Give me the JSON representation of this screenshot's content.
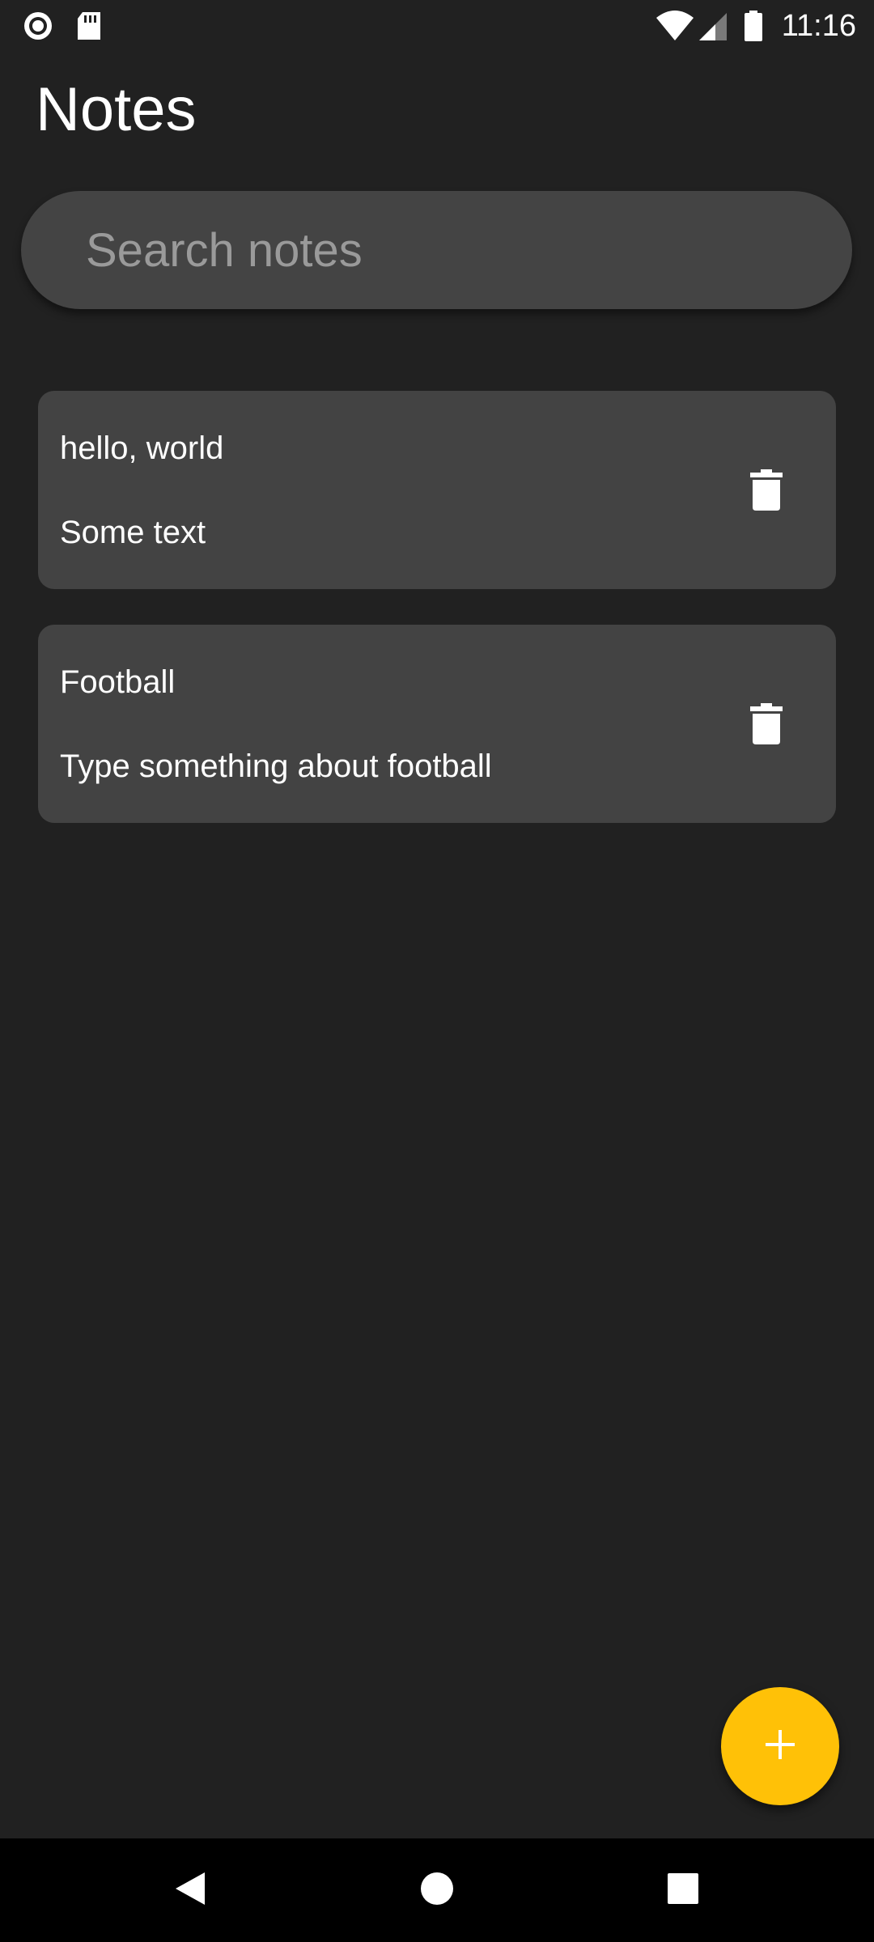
{
  "status_bar": {
    "time": "11:16",
    "left_icons": [
      "record-icon",
      "sd-card-icon"
    ],
    "right_icons": [
      "wifi-icon",
      "cell-signal-icon",
      "battery-icon"
    ]
  },
  "header": {
    "title": "Notes"
  },
  "search": {
    "placeholder": "Search notes",
    "value": ""
  },
  "notes": [
    {
      "title": "hello, world",
      "body": "Some text",
      "action_icon": "trash-icon"
    },
    {
      "title": "Football",
      "body": "Type something about football",
      "action_icon": "trash-icon"
    }
  ],
  "fab": {
    "icon": "plus-icon",
    "color": "#ffc107"
  },
  "nav_bar": {
    "buttons": [
      "back-icon",
      "home-icon",
      "recents-icon"
    ]
  },
  "colors": {
    "background": "#212121",
    "card": "#434343",
    "search": "#444444",
    "accent": "#ffc107",
    "nav_bar": "#000000"
  }
}
